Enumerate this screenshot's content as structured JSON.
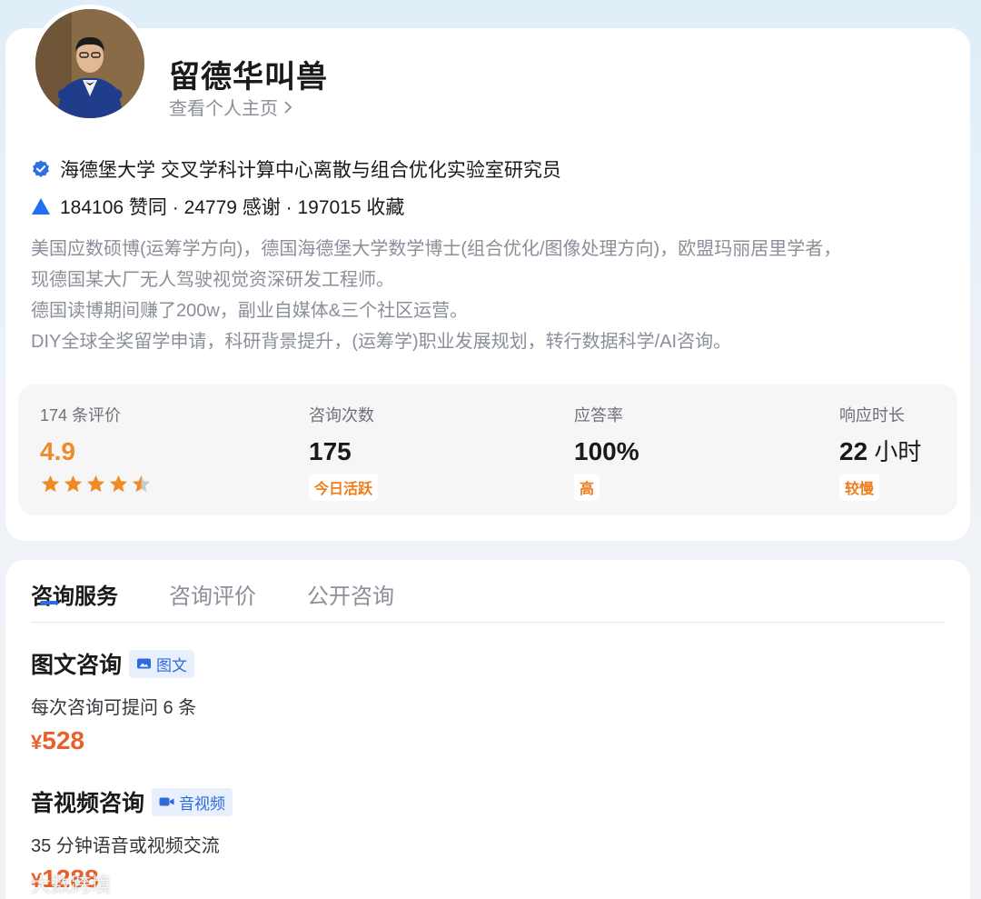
{
  "profile": {
    "name": "留德华叫兽",
    "home_link": "查看个人主页",
    "verification": "海德堡大学 交叉学科计算中心离散与组合优化实验室研究员",
    "stats": "184106 赞同 · 24779 感谢 · 197015 收藏",
    "bio": [
      "美国应数硕博(运筹学方向)，德国海德堡大学数学博士(组合优化/图像处理方向)，欧盟玛丽居里学者，",
      "现德国某大厂无人驾驶视觉资深研发工程师。",
      "德国读博期间赚了200w，副业自媒体&三个社区运营。",
      "DIY全球全奖留学申请，科研背景提升，(运筹学)职业发展规划，转行数据科学/AI咨询。"
    ]
  },
  "metrics": {
    "rating": {
      "label": "174 条评价",
      "value": "4.9",
      "stars": 4.5
    },
    "consults": {
      "label": "咨询次数",
      "value": "175",
      "badge": "今日活跃"
    },
    "response_rate": {
      "label": "应答率",
      "value": "100%",
      "badge": "高"
    },
    "response_time": {
      "label": "响应时长",
      "value": "22",
      "unit": " 小时",
      "badge": "较慢"
    }
  },
  "tabs": [
    "咨询服务",
    "咨询评价",
    "公开咨询"
  ],
  "services": [
    {
      "title": "图文咨询",
      "tag": "图文",
      "desc": "每次咨询可提问 6 条",
      "currency": "¥",
      "price": "528"
    },
    {
      "title": "音视频咨询",
      "tag": "音视频",
      "desc": "35 分钟语音或视频交流",
      "currency": "¥",
      "price": "1288"
    }
  ],
  "watermark": "大数跨境",
  "colors": {
    "accent": "#1f6fef",
    "orange": "#ef8a24",
    "price": "#e8602a"
  },
  "icons": [
    "verified-icon",
    "upvote-icon",
    "star-icon",
    "image-icon",
    "video-icon",
    "chevron-right-icon"
  ]
}
